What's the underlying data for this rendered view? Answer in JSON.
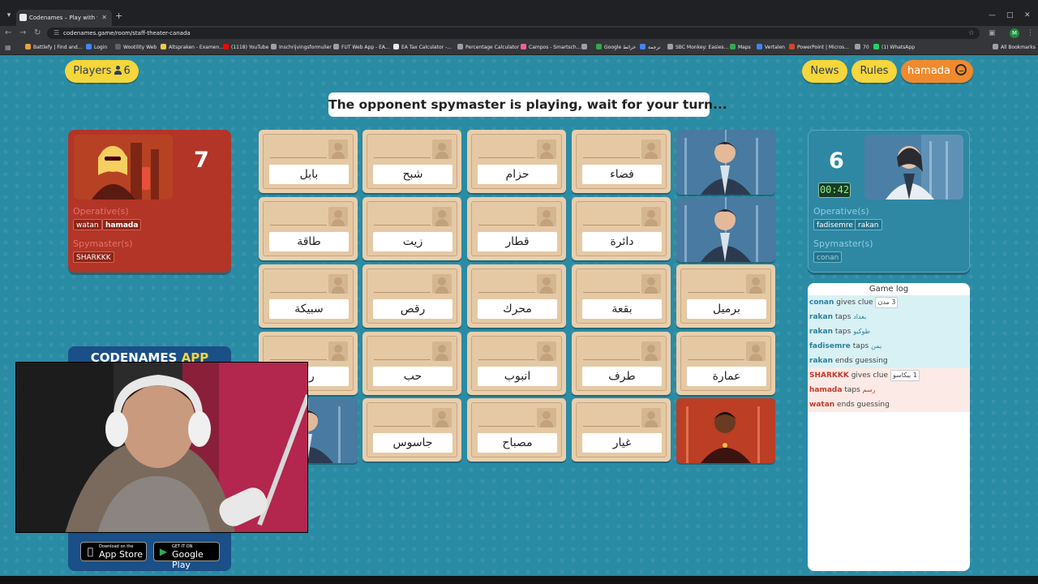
{
  "browser": {
    "tab_title": "Codenames – Play with your Fr...",
    "url": "codenames.game/room/staff-theater-canada",
    "profile_initial": "M",
    "bookmarks": [
      {
        "label": "Battlefy | Find and...",
        "color": "#e8a33a"
      },
      {
        "label": "Login",
        "color": "#4285f4"
      },
      {
        "label": "Wootility Web",
        "color": "#5f6368"
      },
      {
        "label": "Altspraken - Examen...",
        "color": "#f2c94c"
      },
      {
        "label": "(1118) YouTube",
        "color": "#ff0000"
      },
      {
        "label": "Inschrijvingsformulier",
        "color": "#9aa0a6"
      },
      {
        "label": "FUT Web App - EA...",
        "color": "#9aa0a6"
      },
      {
        "label": "EA Tax Calculator -...",
        "color": "#e8eaed"
      },
      {
        "label": "Percentage Calculator",
        "color": "#9aa0a6"
      },
      {
        "label": "Campos - Smartsch...",
        "color": "#f06292"
      },
      {
        "label": "",
        "color": "#9aa0a6"
      },
      {
        "label": "Google خرائط",
        "color": "#34a853"
      },
      {
        "label": "ترجمة",
        "color": "#4285f4"
      },
      {
        "label": "SBC Monkey: Easies...",
        "color": "#9aa0a6"
      },
      {
        "label": "Maps",
        "color": "#34a853"
      },
      {
        "label": "Vertalen",
        "color": "#4285f4"
      },
      {
        "label": "PowerPoint | Micros...",
        "color": "#d24726"
      },
      {
        "label": "70",
        "color": "#9aa0a6"
      },
      {
        "label": "(1) WhatsApp",
        "color": "#25d366"
      }
    ],
    "all_bookmarks": "All Bookmarks"
  },
  "header": {
    "players_label": "Players",
    "players_count": "6",
    "news": "News",
    "rules": "Rules",
    "user": "hamada"
  },
  "status": "The opponent spymaster is playing, wait for your turn...",
  "red_team": {
    "count": "7",
    "operatives_label": "Operative(s)",
    "operatives": [
      "watan",
      "hamada"
    ],
    "spymasters_label": "Spymaster(s)",
    "spymasters": [
      "SHARKKK"
    ]
  },
  "blue_team": {
    "count": "6",
    "timer": "00:42",
    "operatives_label": "Operative(s)",
    "operatives": [
      "fadisemre",
      "rakan"
    ],
    "spymasters_label": "Spymaster(s)",
    "spymasters": [
      "conan"
    ]
  },
  "board": [
    {
      "word": "بابل",
      "state": "hidden"
    },
    {
      "word": "شبح",
      "state": "hidden"
    },
    {
      "word": "حزام",
      "state": "hidden"
    },
    {
      "word": "فضاء",
      "state": "hidden"
    },
    {
      "word": "",
      "state": "blue-agent"
    },
    {
      "word": "طاقة",
      "state": "hidden"
    },
    {
      "word": "زيت",
      "state": "hidden"
    },
    {
      "word": "قطار",
      "state": "hidden"
    },
    {
      "word": "دائرة",
      "state": "hidden"
    },
    {
      "word": "",
      "state": "blue-agent"
    },
    {
      "word": "سبيكة",
      "state": "hidden"
    },
    {
      "word": "رقص",
      "state": "hidden"
    },
    {
      "word": "محرك",
      "state": "hidden"
    },
    {
      "word": "بقعة",
      "state": "hidden"
    },
    {
      "word": "برميل",
      "state": "hidden"
    },
    {
      "word": "رو",
      "state": "hidden"
    },
    {
      "word": "حب",
      "state": "hidden"
    },
    {
      "word": "انبوب",
      "state": "hidden"
    },
    {
      "word": "طرف",
      "state": "hidden"
    },
    {
      "word": "عمارة",
      "state": "hidden"
    },
    {
      "word": "",
      "state": "blue-agent"
    },
    {
      "word": "جاسوس",
      "state": "hidden"
    },
    {
      "word": "مصباح",
      "state": "hidden"
    },
    {
      "word": "غيار",
      "state": "hidden"
    },
    {
      "word": "",
      "state": "red-agent"
    }
  ],
  "log": {
    "title": "Game log",
    "entries": [
      {
        "team": "blue",
        "name": "conan",
        "action": "gives clue",
        "word": "3 مدن",
        "boxed": true
      },
      {
        "team": "blue",
        "name": "rakan",
        "action": "taps",
        "word": "بغداد",
        "boxed": false
      },
      {
        "team": "blue",
        "name": "rakan",
        "action": "taps",
        "word": "طوكيو",
        "boxed": false
      },
      {
        "team": "blue",
        "name": "fadisemre",
        "action": "taps",
        "word": "يمن",
        "boxed": false
      },
      {
        "team": "blue",
        "name": "rakan",
        "action": "ends guessing",
        "word": "",
        "boxed": false
      },
      {
        "team": "red",
        "name": "SHARKKK",
        "action": "gives clue",
        "word": "1 بيكاسو",
        "boxed": true
      },
      {
        "team": "red",
        "name": "hamada",
        "action": "taps",
        "word": "رسم",
        "boxed": false
      },
      {
        "team": "red",
        "name": "watan",
        "action": "ends guessing",
        "word": "",
        "boxed": false
      }
    ]
  },
  "promo": {
    "title_a": "CODENAMES",
    "title_b": "APP",
    "app_store_small": "Download on the",
    "app_store_big": "App Store",
    "google_small": "GET IT ON",
    "google_big": "Google Play"
  }
}
